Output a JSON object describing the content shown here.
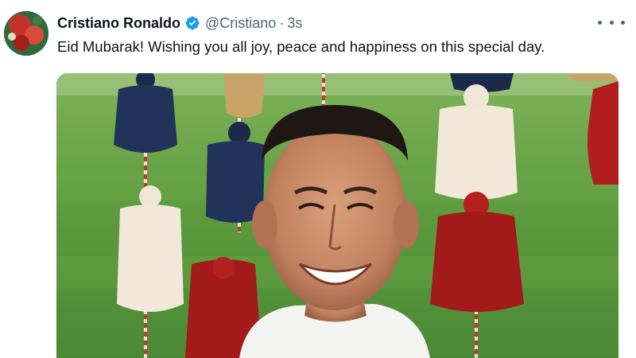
{
  "tweet": {
    "author_name": "Cristiano Ronaldo",
    "verified": true,
    "handle": "@Cristiano",
    "separator": "·",
    "time": "3s",
    "text": "Eid Mubarak! Wishing you all joy, peace and happiness on this special day.",
    "more_icon": "more-horizontal-icon",
    "verified_icon": "verified-badge-icon"
  },
  "colors": {
    "verified_blue": "#1d9bf0",
    "name_text": "#0f1419",
    "secondary_text": "#536471"
  }
}
